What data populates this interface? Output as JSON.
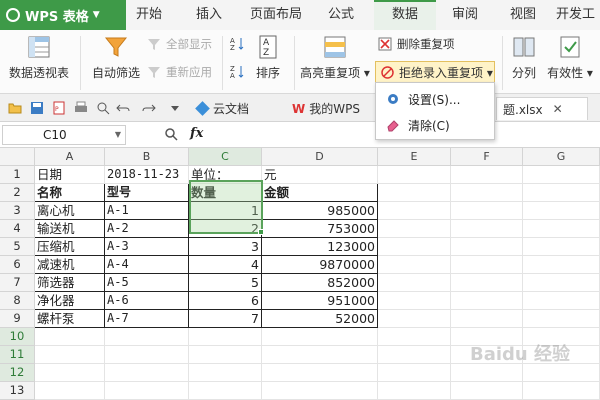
{
  "app": {
    "title": "WPS 表格"
  },
  "menu_tabs": [
    "开始",
    "插入",
    "页面布局",
    "公式",
    "数据",
    "审阅",
    "视图",
    "开发工"
  ],
  "ribbon": {
    "pivot": "数据透视表",
    "autofilter": "自动筛选",
    "show_all": "全部显示",
    "reapply": "重新应用",
    "sort": "排序",
    "highlight_dup": "高亮重复项",
    "remove_dup": "删除重复项",
    "reject_dup": "拒绝录入重复项",
    "split": "分列",
    "validity": "有效性"
  },
  "doc_tabs": {
    "cloud": "云文档",
    "mywps": "我的WPS",
    "file": "题.xlsx"
  },
  "dropdown": {
    "settings": "设置(S)...",
    "clear": "清除(C)"
  },
  "name_box": "C10",
  "fx_label": "fx",
  "columns": [
    "A",
    "B",
    "C",
    "D",
    "E",
    "F",
    "G"
  ],
  "rows": [
    "1",
    "2",
    "3",
    "4",
    "5",
    "6",
    "7",
    "8",
    "9",
    "10",
    "11",
    "12",
    "13"
  ],
  "cells": {
    "r1": [
      "日期",
      "2018-11-23",
      "单位：",
      "元"
    ],
    "header": [
      "名称",
      "型号",
      "数量",
      "金额"
    ],
    "data": [
      [
        "离心机",
        "A-1",
        "1",
        "985000"
      ],
      [
        "输送机",
        "A-2",
        "2",
        "753000"
      ],
      [
        "压缩机",
        "A-3",
        "3",
        "123000"
      ],
      [
        "减速机",
        "A-4",
        "4",
        "9870000"
      ],
      [
        "筛选器",
        "A-5",
        "5",
        "852000"
      ],
      [
        "净化器",
        "A-6",
        "6",
        "951000"
      ],
      [
        "螺杆泵",
        "A-7",
        "7",
        "52000"
      ]
    ]
  },
  "colors": {
    "accent": "#3e9a48",
    "selection": "#5aa35b"
  },
  "watermark": "Baidu 经验"
}
